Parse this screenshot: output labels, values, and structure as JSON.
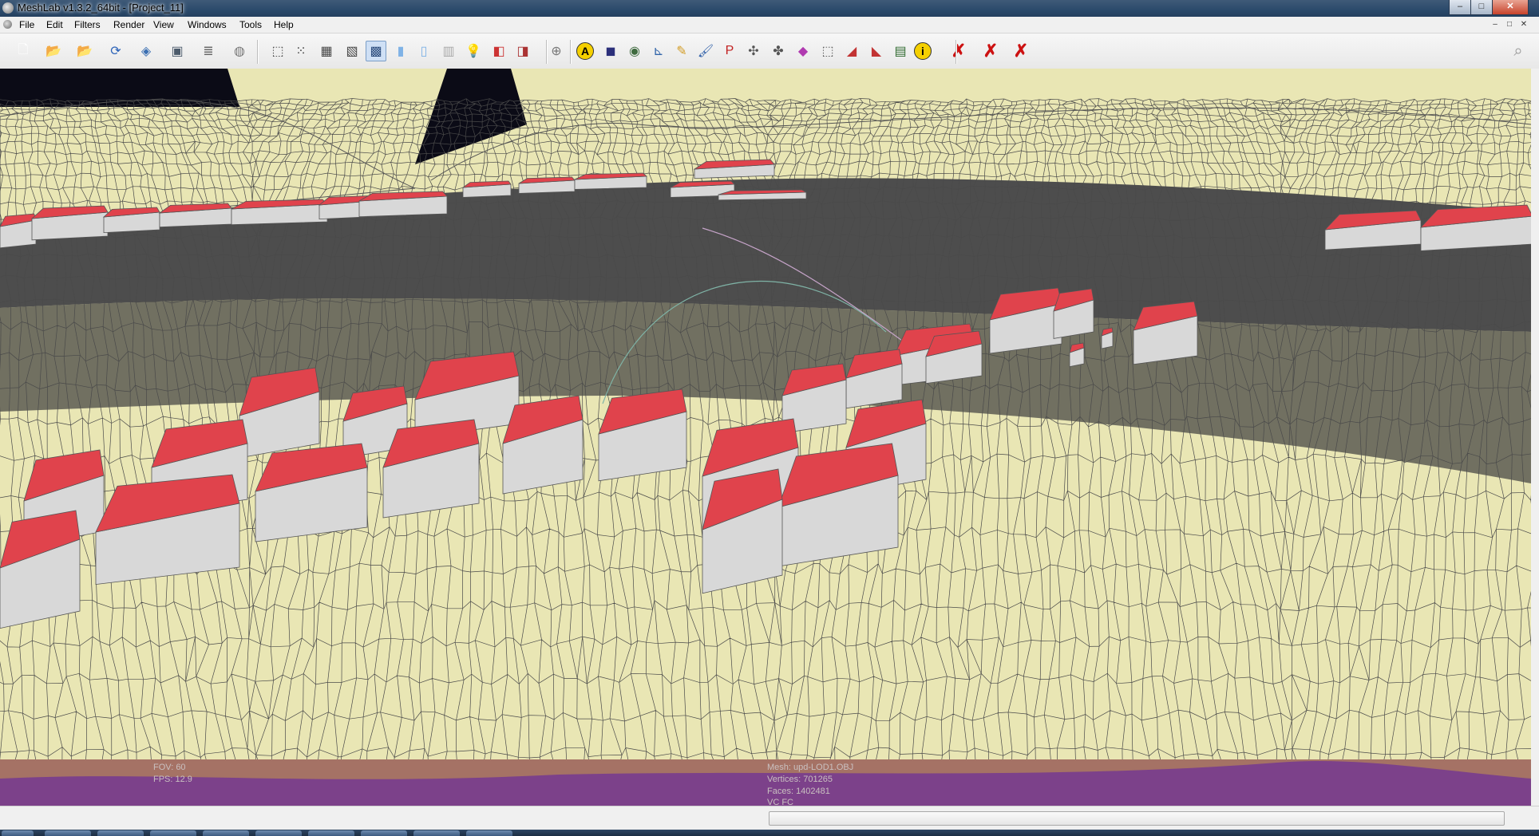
{
  "window": {
    "title": "MeshLab v1.3.2_64bit - [Project_11]",
    "minimize": "–",
    "maximize": "□",
    "close": "✕"
  },
  "menu": [
    "File",
    "Edit",
    "Filters",
    "Render",
    "View",
    "Windows",
    "Tools",
    "Help"
  ],
  "toolbar": {
    "icons": [
      {
        "name": "new-project-icon",
        "glyph": "🗋",
        "color": "#ffffff"
      },
      {
        "name": "open-project-icon",
        "glyph": "📂",
        "color": "#e3a21a"
      },
      {
        "name": "import-mesh-icon",
        "glyph": "📂",
        "color": "#e3a21a"
      },
      {
        "name": "reload-icon",
        "glyph": "⟳",
        "color": "#2c63b8"
      },
      {
        "name": "export-mesh-icon",
        "glyph": "◈",
        "color": "#3b6fb2"
      },
      {
        "name": "snapshot-icon",
        "glyph": "▣",
        "color": "#4b5a6b"
      },
      {
        "name": "layers-icon",
        "glyph": "≣",
        "color": "#6a6a6a"
      },
      {
        "name": "show-layer-icon",
        "glyph": "◍",
        "color": "#777777"
      },
      {
        "name": "bounding-box-icon",
        "glyph": "⬚",
        "color": "#444444"
      },
      {
        "name": "points-icon",
        "glyph": "⁙",
        "color": "#444444"
      },
      {
        "name": "wireframe-icon",
        "glyph": "▦",
        "color": "#444444"
      },
      {
        "name": "hidden-lines-icon",
        "glyph": "▧",
        "color": "#444444"
      },
      {
        "name": "flat-lines-icon",
        "glyph": "▩",
        "color": "#2a4b7c"
      },
      {
        "name": "flat-icon",
        "glyph": "▮",
        "color": "#7fb2e6"
      },
      {
        "name": "smooth-icon",
        "glyph": "▯",
        "color": "#7fb2e6"
      },
      {
        "name": "texture-icon",
        "glyph": "▥",
        "color": "#aaaaaa"
      },
      {
        "name": "lighting-icon",
        "glyph": "💡",
        "color": "#333333"
      },
      {
        "name": "double-lighting-icon",
        "glyph": "◧",
        "color": "#cc3333"
      },
      {
        "name": "backface-culling-icon",
        "glyph": "◨",
        "color": "#aa3333"
      },
      {
        "name": "trackball-icon",
        "glyph": "⊕",
        "color": "#777777"
      },
      {
        "name": "axes-decorator-icon",
        "glyph": "A",
        "color": "#000000"
      },
      {
        "name": "camera-info-icon",
        "glyph": "◼",
        "color": "#2b2f7a"
      },
      {
        "name": "selection-render-icon",
        "glyph": "◉",
        "color": "#3f6b3f"
      },
      {
        "name": "axis-icon",
        "glyph": "⊾",
        "color": "#3366aa"
      },
      {
        "name": "paint-icon",
        "glyph": "✎",
        "color": "#d29b22"
      },
      {
        "name": "brush-icon",
        "glyph": "🖌",
        "color": "#2f5fa8"
      },
      {
        "name": "pick-points-icon",
        "glyph": "P",
        "color": "#c22222"
      },
      {
        "name": "align-icon",
        "glyph": "✣",
        "color": "#555555"
      },
      {
        "name": "measure-icon",
        "glyph": "✤",
        "color": "#555555"
      },
      {
        "name": "color-paint-icon",
        "glyph": "◆",
        "color": "#b03ab0"
      },
      {
        "name": "select-vertices-icon",
        "glyph": "⬚",
        "color": "#555555"
      },
      {
        "name": "select-faces-icon",
        "glyph": "◢",
        "color": "#c23333"
      },
      {
        "name": "select-connected-icon",
        "glyph": "◣",
        "color": "#c23333"
      },
      {
        "name": "raster-icon",
        "glyph": "▤",
        "color": "#2f6a2f"
      },
      {
        "name": "info-icon",
        "glyph": "i",
        "color": "#000000"
      },
      {
        "name": "delete-vertices-icon",
        "glyph": "✗",
        "color": "#cc1111"
      },
      {
        "name": "delete-faces-icon",
        "glyph": "✗",
        "color": "#cc1111"
      },
      {
        "name": "delete-faces-vertices-icon",
        "glyph": "✗",
        "color": "#cc1111"
      }
    ],
    "search_glyph": "⌕"
  },
  "hud": {
    "left_line1": "FOV: 60",
    "left_line2": "FPS:   12.9",
    "right_line1": "Mesh: upd-LOD1.OBJ",
    "right_line2": "Vertices: 701265",
    "right_line3": "Faces: 1402481",
    "right_line4": "VC FC"
  },
  "colors": {
    "terrain": "#e9e6b4",
    "mesh_line": "#4a4a4a",
    "roof": "#e0434c",
    "wall": "#d8d8d8",
    "hud_band": "#a57265",
    "hud_purple": "#7c418a"
  }
}
